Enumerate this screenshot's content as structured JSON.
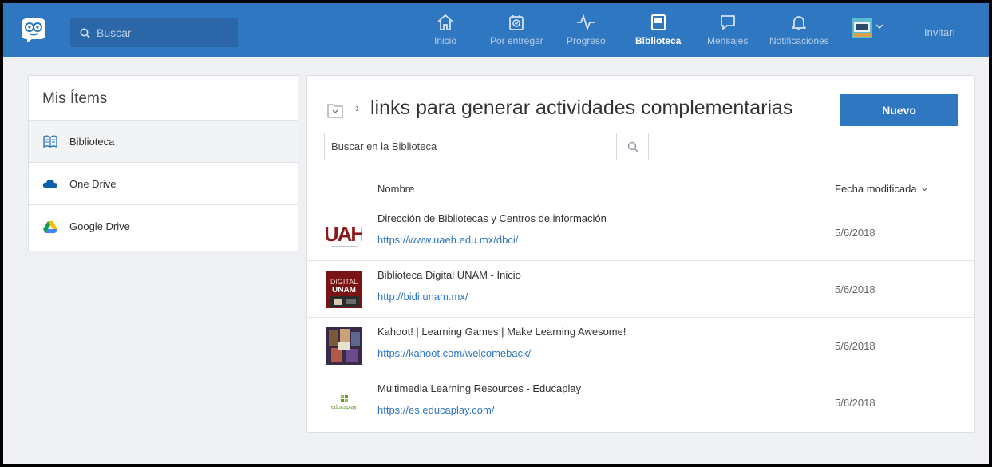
{
  "topbar": {
    "search_placeholder": "Buscar",
    "nav": [
      {
        "label": "Inicio",
        "icon": "home-icon"
      },
      {
        "label": "Por entregar",
        "icon": "assignment-icon"
      },
      {
        "label": "Progreso",
        "icon": "pulse-icon"
      },
      {
        "label": "Biblioteca",
        "icon": "library-icon",
        "active": true
      },
      {
        "label": "Mensajes",
        "icon": "message-icon"
      },
      {
        "label": "Notificaciones",
        "icon": "bell-icon"
      }
    ],
    "invite_label": "Invitar!"
  },
  "sidebar": {
    "title": "Mis Ítems",
    "items": [
      {
        "label": "Biblioteca",
        "icon": "book-icon",
        "active": true
      },
      {
        "label": "One Drive",
        "icon": "onedrive-icon"
      },
      {
        "label": "Google Drive",
        "icon": "google-drive-icon"
      }
    ]
  },
  "main": {
    "title": "links para generar actividades complementarias",
    "new_button": "Nuevo",
    "search_placeholder": "Buscar en la Biblioteca",
    "columns": {
      "name": "Nombre",
      "date": "Fecha modificada"
    },
    "rows": [
      {
        "title": "Dirección de Bibliotecas y Centros de información",
        "url": "https://www.uaeh.edu.mx/dbci/",
        "date": "5/6/2018"
      },
      {
        "title": "Biblioteca Digital UNAM - Inicio",
        "url": "http://bidi.unam.mx/",
        "date": "5/6/2018"
      },
      {
        "title": "Kahoot! | Learning Games | Make Learning Awesome!",
        "url": "https://kahoot.com/welcomeback/",
        "date": "5/6/2018"
      },
      {
        "title": "Multimedia Learning Resources - Educaplay",
        "url": "https://es.educaplay.com/",
        "date": "5/6/2018"
      }
    ],
    "thumb_texts": {
      "uaeh": "UAH",
      "unam": "DIGITAL UNAM",
      "educaplay": "educaplay"
    }
  },
  "colors": {
    "brand": "#2f77c0",
    "link": "#2f77c0"
  }
}
